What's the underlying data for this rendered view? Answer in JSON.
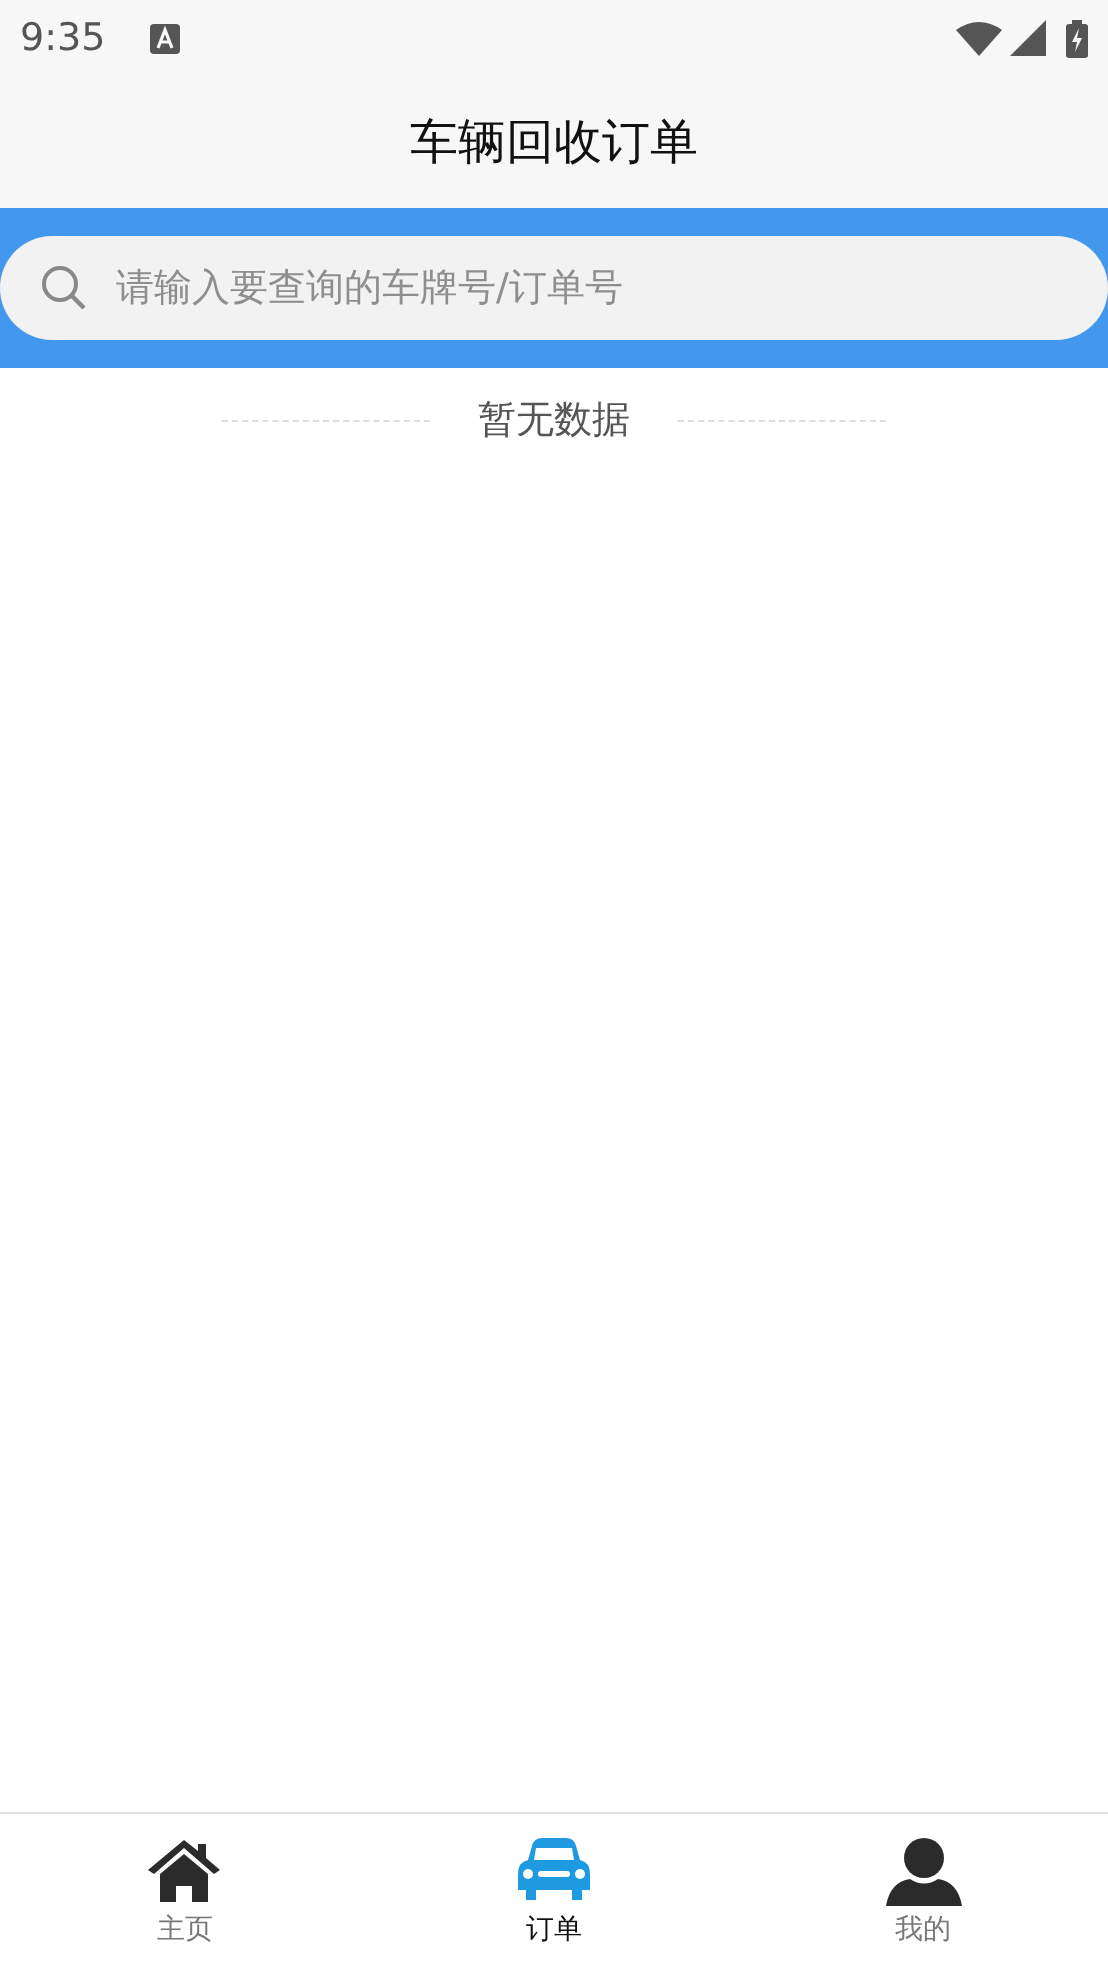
{
  "status_bar": {
    "time": "9:35"
  },
  "header": {
    "title": "车辆回收订单"
  },
  "search": {
    "placeholder": "请输入要查询的车牌号/订单号"
  },
  "empty_note": "暂无数据",
  "tabs": [
    {
      "label": "主页",
      "kind": "home",
      "selected": false
    },
    {
      "label": "订单",
      "kind": "car",
      "selected": true
    },
    {
      "label": "我的",
      "kind": "person",
      "selected": false
    }
  ]
}
